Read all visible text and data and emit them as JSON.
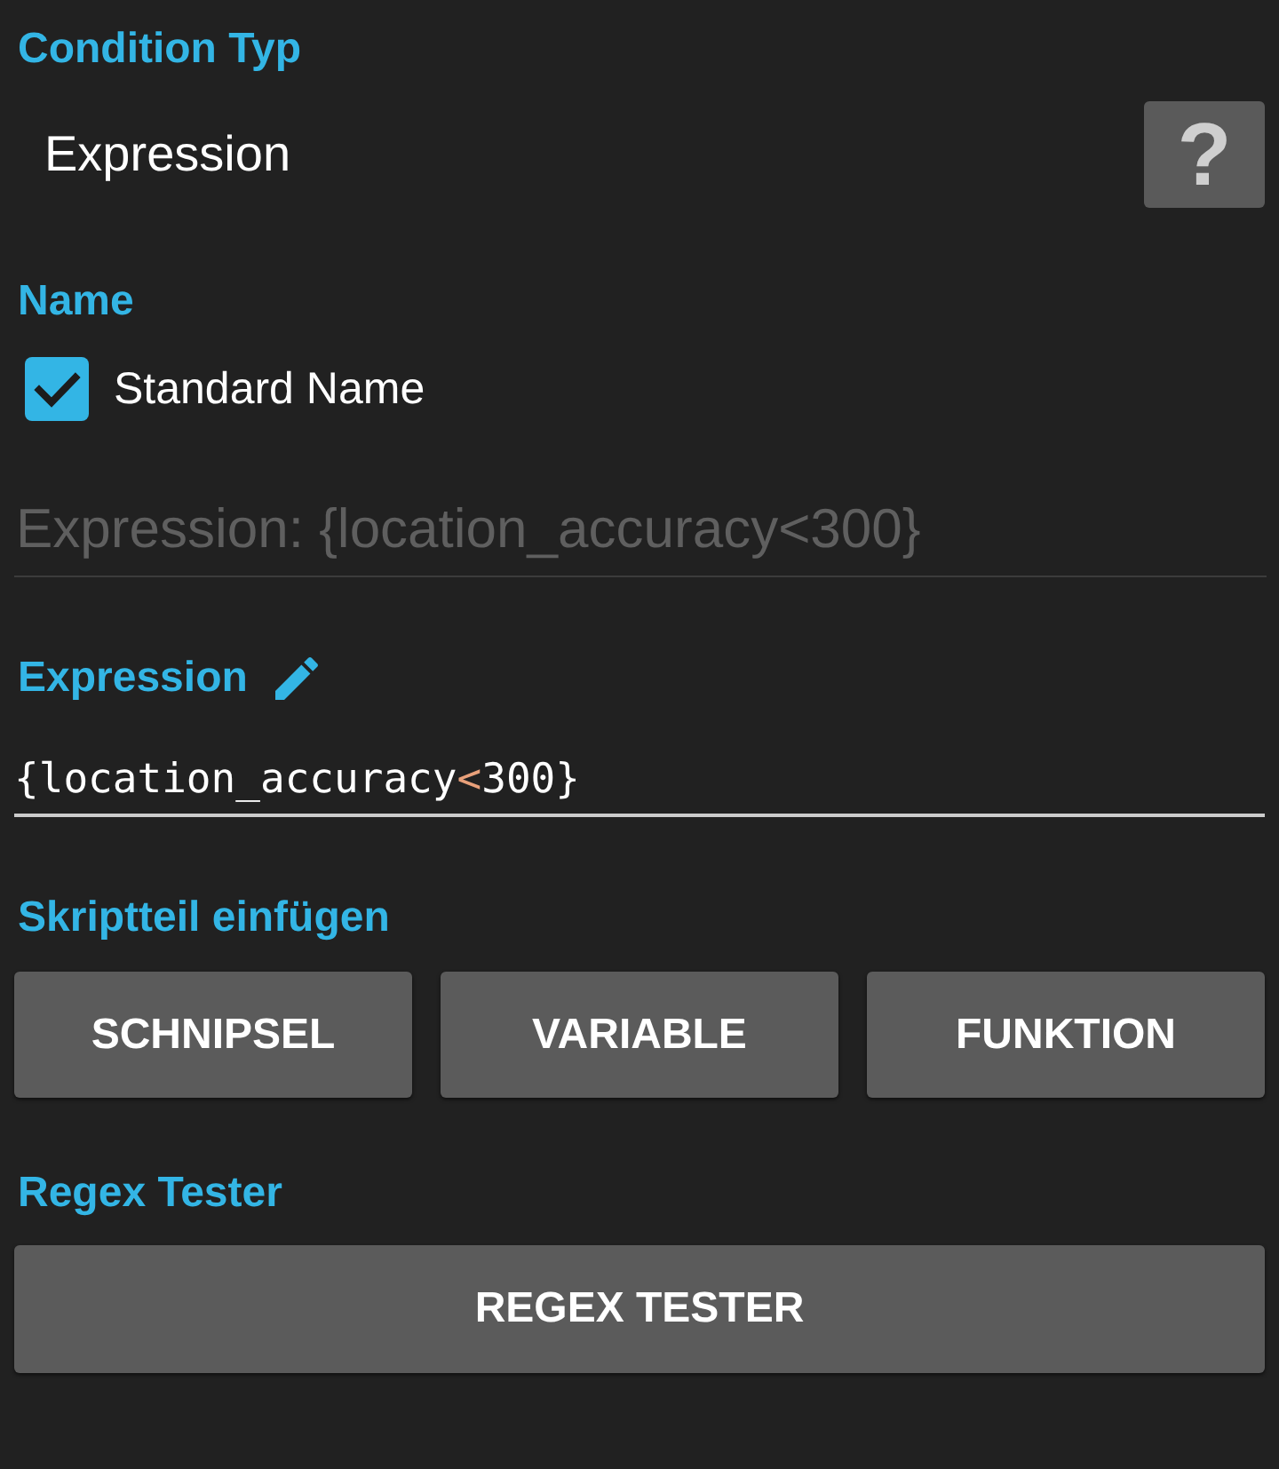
{
  "condition_type": {
    "heading": "Condition Typ",
    "value": "Expression",
    "help_button": "?"
  },
  "name": {
    "heading": "Name",
    "checkbox": {
      "label": "Standard Name",
      "checked": true
    },
    "field": {
      "value": "Expression: {location_accuracy<300}",
      "disabled": true
    }
  },
  "expression": {
    "heading": "Expression",
    "field": {
      "tokens": [
        {
          "text": "{location_accuracy",
          "kind": "plain"
        },
        {
          "text": "<",
          "kind": "operator"
        },
        {
          "text": "300}",
          "kind": "plain"
        }
      ]
    }
  },
  "snippets": {
    "heading": "Skriptteil einfügen",
    "buttons": [
      "SCHNIPSEL",
      "VARIABLE",
      "FUNKTION"
    ]
  },
  "regex": {
    "heading": "Regex Tester",
    "button": "REGEX TESTER"
  }
}
